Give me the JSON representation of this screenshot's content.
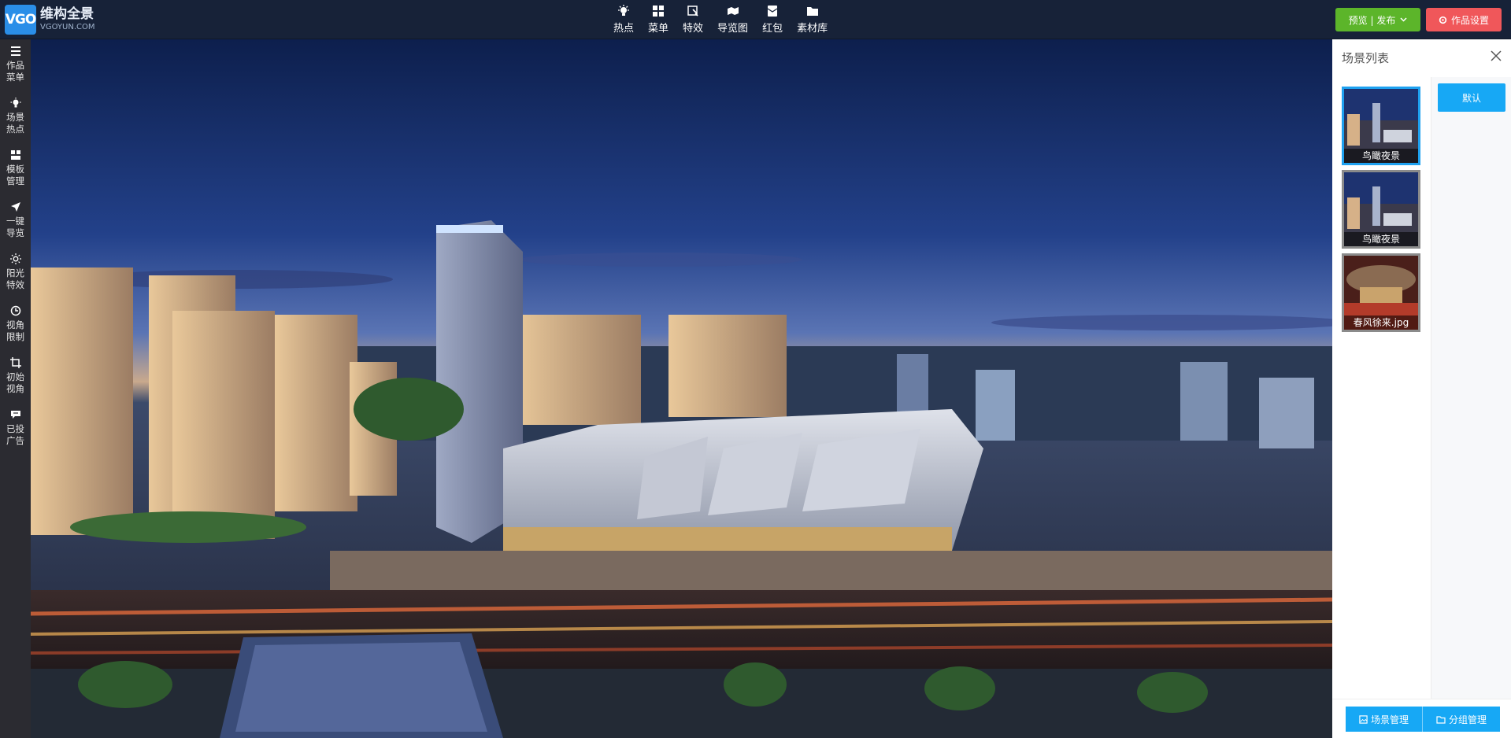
{
  "logo": {
    "badge": "VGO",
    "name_cn": "维构全景",
    "name_en": "VGOYUN.COM"
  },
  "topnav": [
    {
      "label": "热点",
      "icon": "bulb-icon"
    },
    {
      "label": "菜单",
      "icon": "grid-icon"
    },
    {
      "label": "特效",
      "icon": "sparkle-icon"
    },
    {
      "label": "导览图",
      "icon": "map-icon"
    },
    {
      "label": "红包",
      "icon": "envelope-icon"
    },
    {
      "label": "素材库",
      "icon": "folder-icon"
    }
  ],
  "actions": {
    "preview_publish": "预览 | 发布",
    "work_settings": "作品设置"
  },
  "sidebar": [
    {
      "label": "作品菜单",
      "icon": "menu-icon"
    },
    {
      "label": "场景热点",
      "icon": "bulb-icon"
    },
    {
      "label": "模板管理",
      "icon": "template-icon"
    },
    {
      "label": "一键导览",
      "icon": "navigate-icon"
    },
    {
      "label": "阳光特效",
      "icon": "sun-icon"
    },
    {
      "label": "视角限制",
      "icon": "clock-icon"
    },
    {
      "label": "初始视角",
      "icon": "crop-icon"
    },
    {
      "label": "已投广告",
      "icon": "ad-icon"
    }
  ],
  "panel": {
    "title": "场景列表",
    "default_group": "默认",
    "scenes": [
      {
        "caption": "鸟瞰夜景",
        "active": true
      },
      {
        "caption": "鸟瞰夜景",
        "active": false
      },
      {
        "caption": "春风徐来.jpg",
        "active": false
      }
    ],
    "scene_manage": "场景管理",
    "group_manage": "分组管理"
  },
  "colors": {
    "topbar": "#172238",
    "accent": "#17a8f5",
    "preview_green": "#5cb52a",
    "settings_red": "#f0575a"
  }
}
